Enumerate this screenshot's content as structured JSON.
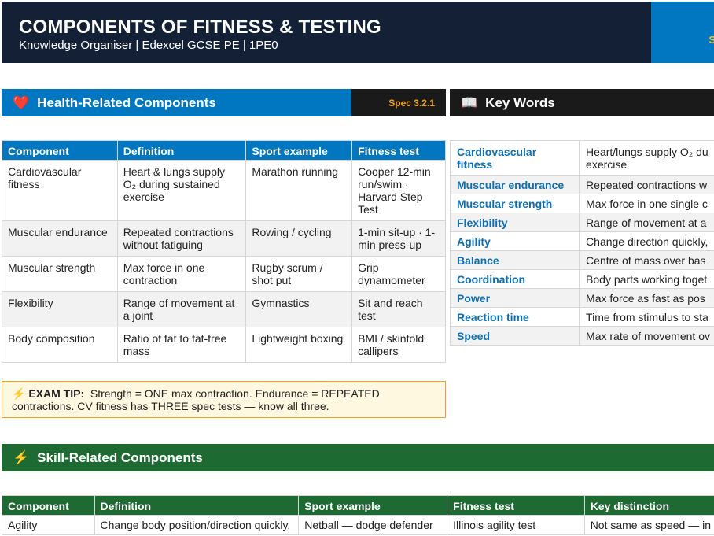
{
  "header": {
    "title": "COMPONENTS OF FITNESS & TESTING",
    "subtitle": "Knowledge Organiser  |  Edexcel GCSE PE  |  1PE0",
    "edge_text": "S"
  },
  "health": {
    "title": "Health-Related Components",
    "spec": "Spec 3.2.1",
    "columns": [
      "Component",
      "Definition",
      "Sport example",
      "Fitness test"
    ],
    "rows": [
      [
        "Cardiovascular fitness",
        "Heart & lungs supply O₂ during sustained exercise",
        "Marathon running",
        "Cooper 12-min run/swim · Harvard Step Test"
      ],
      [
        "Muscular endurance",
        "Repeated contractions without fatiguing",
        "Rowing / cycling",
        "1-min sit-up · 1-min press-up"
      ],
      [
        "Muscular strength",
        "Max force in one contraction",
        "Rugby scrum / shot put",
        "Grip dynamometer"
      ],
      [
        "Flexibility",
        "Range of movement at a joint",
        "Gymnastics",
        "Sit and reach test"
      ],
      [
        "Body composition",
        "Ratio of fat to fat-free mass",
        "Lightweight boxing",
        "BMI / skinfold callipers"
      ]
    ]
  },
  "keywords": {
    "title": "Key Words",
    "items": [
      {
        "term": "Cardiovascular fitness",
        "def": "Heart/lungs supply O₂ du",
        "def2": "exercise"
      },
      {
        "term": "Muscular endurance",
        "def": "Repeated contractions w"
      },
      {
        "term": "Muscular strength",
        "def": "Max force in one single c"
      },
      {
        "term": "Flexibility",
        "def": "Range of movement at a"
      },
      {
        "term": "Agility",
        "def": "Change direction quickly,"
      },
      {
        "term": "Balance",
        "def": "Centre of mass over bas"
      },
      {
        "term": "Coordination",
        "def": "Body parts working toget"
      },
      {
        "term": "Power",
        "def": "Max force as fast as pos"
      },
      {
        "term": "Reaction time",
        "def": "Time from stimulus to sta"
      },
      {
        "term": "Speed",
        "def": "Max rate of movement ov"
      }
    ]
  },
  "tip": {
    "label": "EXAM TIP:",
    "text": "Strength = ONE max contraction. Endurance = REPEATED contractions. CV fitness has THREE spec tests — know all three."
  },
  "skill": {
    "title": "Skill-Related Components",
    "columns": [
      "Component",
      "Definition",
      "Sport example",
      "Fitness test",
      "Key distinction"
    ],
    "rows": [
      [
        "Agility",
        "Change body position/direction quickly,",
        "Netball — dodge defender",
        "Illinois agility test",
        "Not same as speed — in"
      ]
    ]
  },
  "colors": {
    "navy": "#132036",
    "blue": "#0077c0",
    "green": "#1e6a33",
    "gold": "#f2a318",
    "key_term": "#0d6fb0"
  },
  "icons": {
    "health": "heart-icon",
    "keywords": "book-icon",
    "tip": "lightning-icon",
    "skill": "lightning-icon"
  }
}
